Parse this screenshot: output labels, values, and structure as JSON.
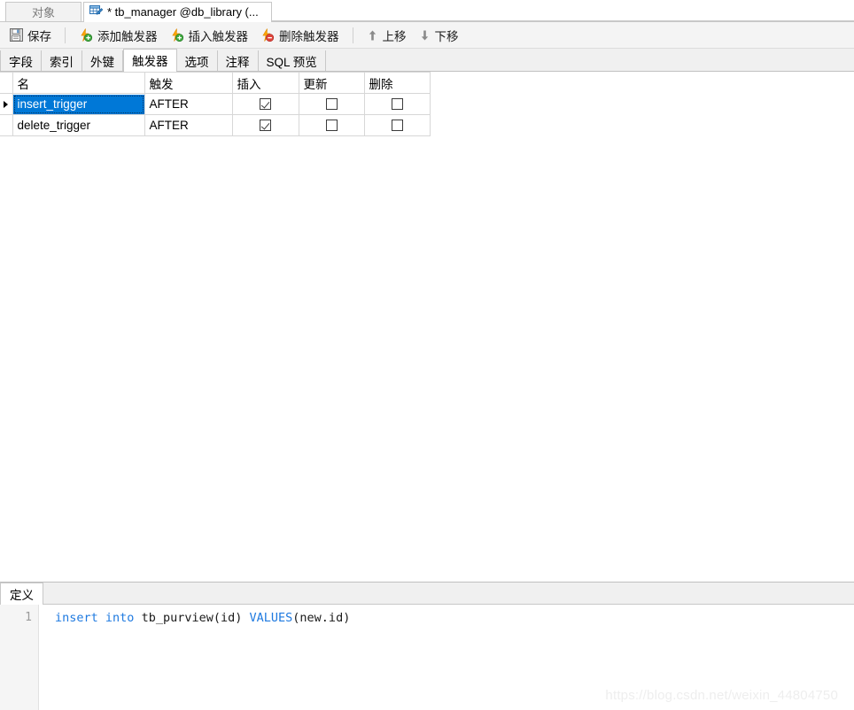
{
  "window_tabs": [
    {
      "label": "对象",
      "active": false,
      "icon": ""
    },
    {
      "label": "* tb_manager @db_library (...",
      "active": true,
      "icon": "table-edit-icon"
    }
  ],
  "toolbar": {
    "save_label": "保存",
    "add_trigger_label": "添加触发器",
    "insert_trigger_label": "插入触发器",
    "delete_trigger_label": "删除触发器",
    "move_up_label": "上移",
    "move_down_label": "下移"
  },
  "subtabs": [
    {
      "label": "字段",
      "active": false
    },
    {
      "label": "索引",
      "active": false
    },
    {
      "label": "外键",
      "active": false
    },
    {
      "label": "触发器",
      "active": true
    },
    {
      "label": "选项",
      "active": false
    },
    {
      "label": "注释",
      "active": false
    },
    {
      "label": "SQL 预览",
      "active": false
    }
  ],
  "grid": {
    "columns": [
      "名",
      "触发",
      "插入",
      "更新",
      "删除"
    ],
    "rows": [
      {
        "name": "insert_trigger",
        "timing": "AFTER",
        "insert": true,
        "update": false,
        "delete": false,
        "selected": true
      },
      {
        "name": "delete_trigger",
        "timing": "AFTER",
        "insert": true,
        "update": false,
        "delete": false,
        "selected": false
      }
    ]
  },
  "definition": {
    "tab_label": "定义",
    "line_number": "1",
    "code": {
      "kw1": "insert",
      "kw2": "into",
      "target": "tb_purview(id)",
      "kw3": "VALUES",
      "args": "(new.id)"
    }
  },
  "watermark": "https://blog.csdn.net/weixin_44804750",
  "colors": {
    "selection": "#0078d7",
    "keyword": "#1f7ae0",
    "toolbar_bg": "#f4f4f4",
    "bolt": "#ffa500",
    "add_badge": "#3faa3f",
    "remove_badge": "#e0453c"
  }
}
